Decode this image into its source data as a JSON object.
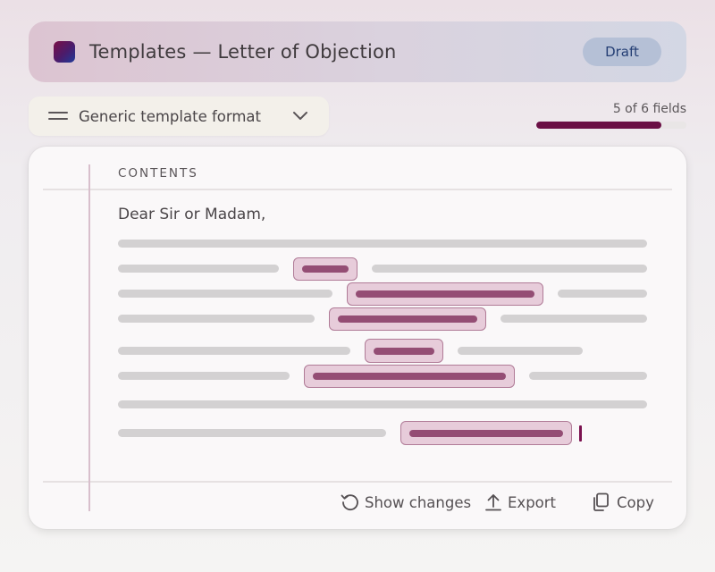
{
  "header": {
    "title": "Templates — Letter of Objection",
    "status": "Draft"
  },
  "format": {
    "label": "Generic template format"
  },
  "progress": {
    "text": "5 of 6 fields",
    "completed": 5,
    "total": 6
  },
  "document": {
    "section_label": "CONTENTS",
    "greeting": "Dear Sir or Madam,"
  },
  "actions": {
    "show_changes": "Show changes",
    "export": "Export",
    "copy": "Copy"
  },
  "colors": {
    "accent": "#6a0f45",
    "field_fill": "#e7ccda",
    "field_border": "#b07b97",
    "badge_bg": "#b5c0d6",
    "badge_text": "#243e74"
  },
  "icons": {
    "app": "app-logo-icon",
    "menu": "menu-lines-icon",
    "chevron": "chevron-down-icon",
    "history": "history-icon",
    "upload": "upload-icon",
    "copy": "copy-icon"
  }
}
